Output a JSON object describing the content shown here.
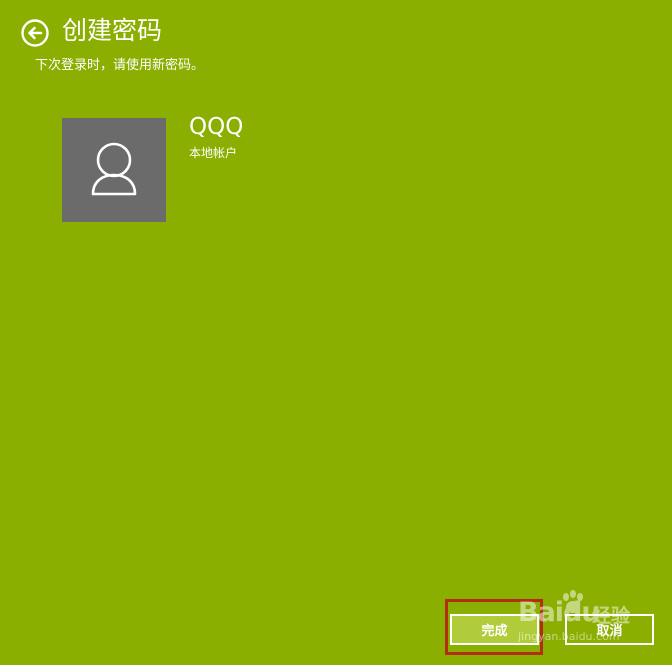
{
  "header": {
    "title": "创建密码",
    "subtitle": "下次登录时，请使用新密码。",
    "back_icon": "back-arrow-icon"
  },
  "account": {
    "name": "QQQ",
    "type": "本地帐户",
    "avatar_icon": "user-icon"
  },
  "actions": {
    "finish_label": "完成",
    "cancel_label": "取消"
  },
  "watermark": {
    "brand": "Baidu",
    "brand_cn": "经验",
    "url": "jingyan.baidu.com"
  },
  "colors": {
    "background": "#8aaf00",
    "avatar_background": "#6b6b6b",
    "finish_button": "#b0cc3a",
    "highlight_border": "#b22e12",
    "text": "#ffffff"
  }
}
